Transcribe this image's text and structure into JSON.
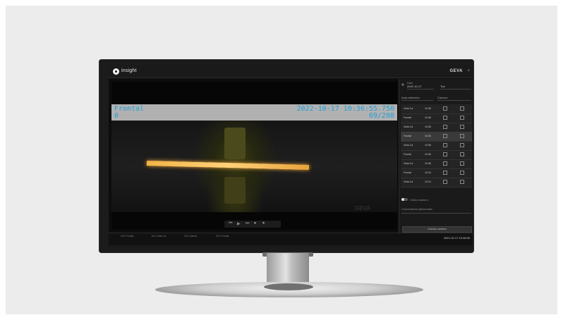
{
  "app": {
    "logo_text": "insight",
    "brand": "GEVA",
    "close_glyph": "×"
  },
  "video": {
    "camera_name": "Frontal",
    "camera_index": "0",
    "timestamp": "2022-10-17 10:36:55.750",
    "frame_counter": "69/208",
    "watermark": "GEVA",
    "progress_fraction": 0.33,
    "controls": [
      "⏮",
      "▶",
      "⏭",
      "⏹",
      "⏺"
    ]
  },
  "side_panel": {
    "date_label": "Date",
    "date_value": "2022-10-17",
    "shift_value": "Tue",
    "filter_left": "Auto-detection",
    "filter_right": "Camera",
    "rows": [
      {
        "camera": "Vista Ca",
        "time": "10:36"
      },
      {
        "camera": "Frontal",
        "time": "10:36"
      },
      {
        "camera": "Vista Ca",
        "time": "10:36"
      },
      {
        "camera": "Frontal",
        "time": "10:36"
      },
      {
        "camera": "Vista Ca",
        "time": "10:36"
      },
      {
        "camera": "Frontal",
        "time": "10:36"
      },
      {
        "camera": "Vista Ca",
        "time": "10:36"
      },
      {
        "camera": "Frontal",
        "time": "10:15"
      },
      {
        "camera": "Vista Ca",
        "time": "10:14"
      }
    ],
    "highlight_row": 3,
    "toggle_label": "Video markers",
    "comment_label": "Comentarios adicionales",
    "apply_label": "Guardar cambios"
  },
  "timeline": {
    "ticks": [
      "15:0 Frontal",
      "15:0 Vista Ca",
      "15:0 Lateral",
      "15:0 Frontal"
    ],
    "end_label": "2022-10-17 10:36:55"
  }
}
